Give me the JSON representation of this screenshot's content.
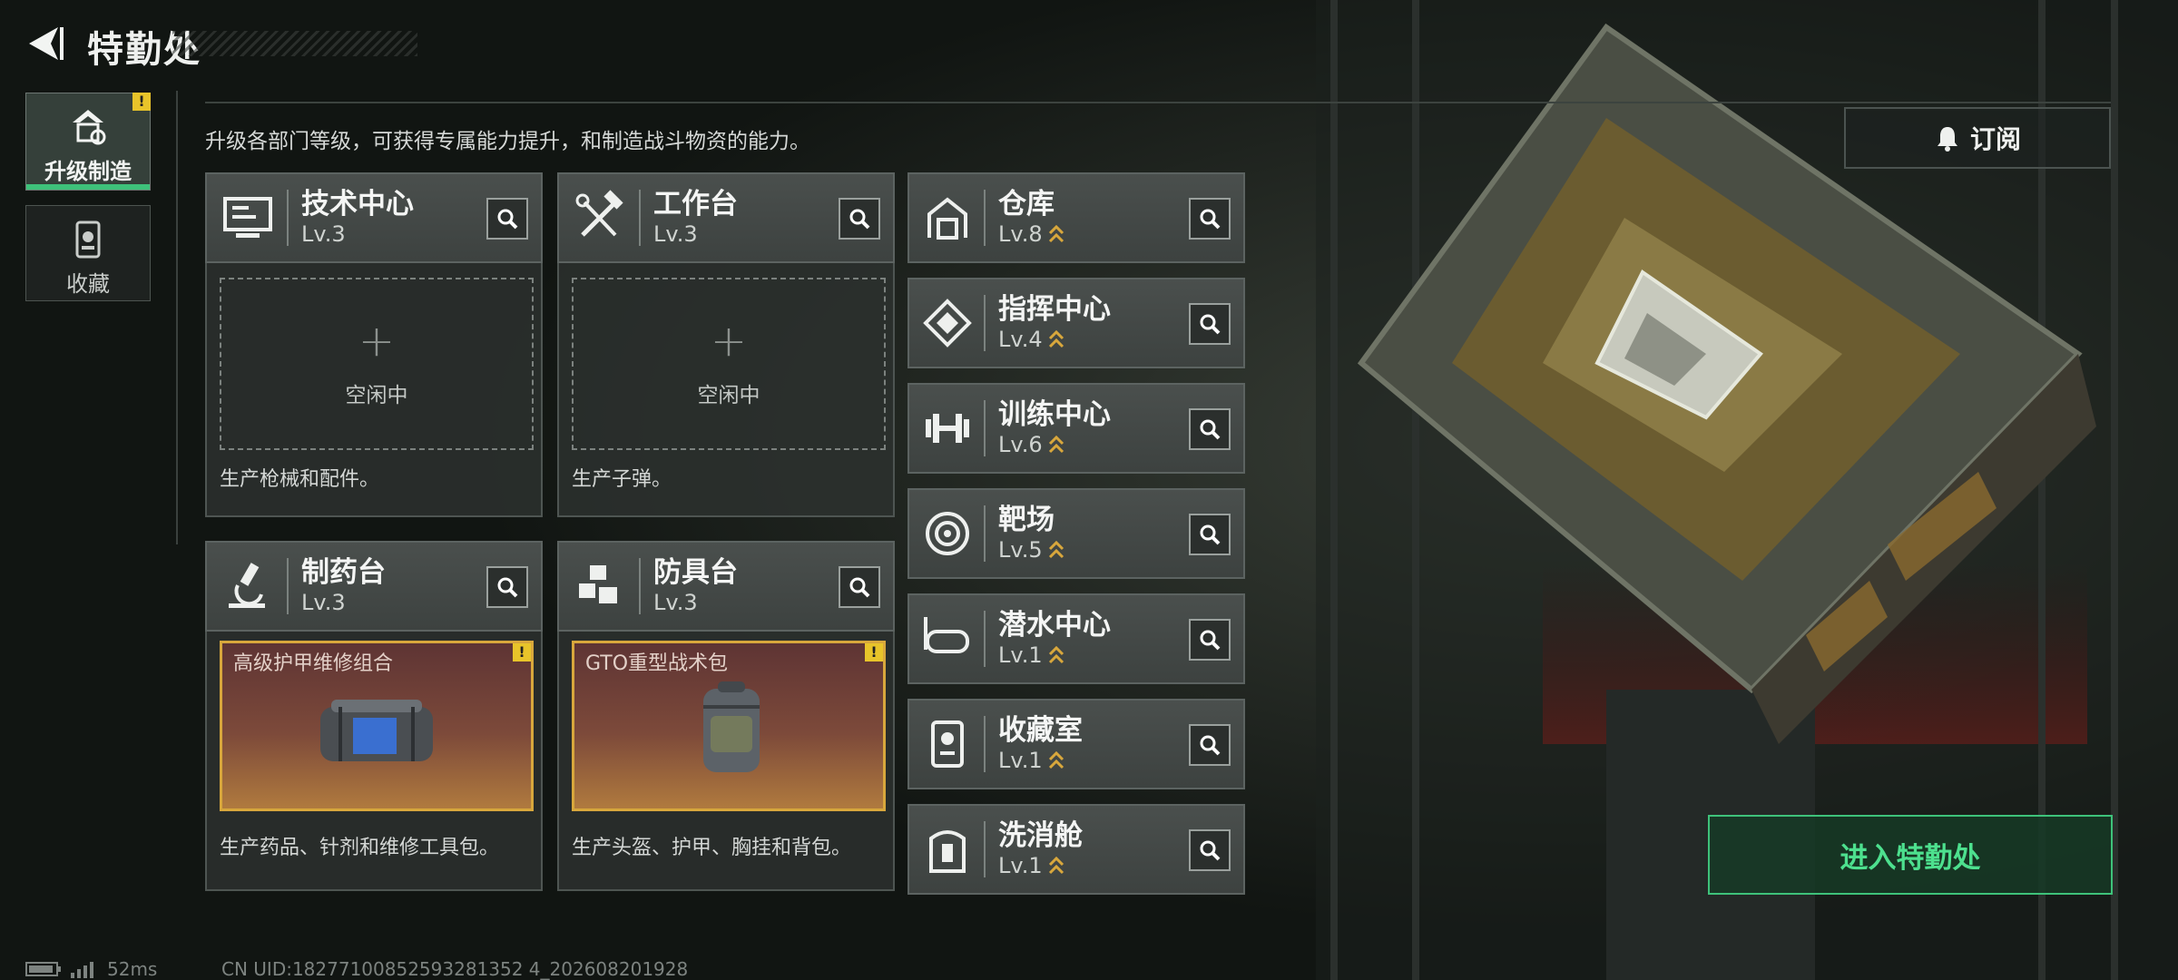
{
  "header": {
    "title": "特勤处"
  },
  "nav": [
    {
      "label": "升级制造",
      "icon": "upgrade-icon",
      "alert": "!"
    },
    {
      "label": "收藏",
      "icon": "collection-icon"
    }
  ],
  "description": "升级各部门等级，可获得专属能力提升，和制造战斗物资的能力。",
  "subscribe": {
    "label": "订阅",
    "icon": "bell-icon"
  },
  "workstations": [
    {
      "name": "技术中心",
      "level": "Lv.3",
      "icon": "monitor-icon",
      "slot_status": "空闲中",
      "plus": "+",
      "desc": "生产枪械和配件。"
    },
    {
      "name": "工作台",
      "level": "Lv.3",
      "icon": "hammer-wrench-icon",
      "slot_status": "空闲中",
      "plus": "+",
      "desc": "生产子弹。"
    },
    {
      "name": "制药台",
      "level": "Lv.3",
      "icon": "microscope-icon",
      "product": "高级护甲维修组合",
      "product_alert": "!",
      "desc": "生产药品、针剂和维修工具包。"
    },
    {
      "name": "防具台",
      "level": "Lv.3",
      "icon": "armor-blocks-icon",
      "product": "GTO重型战术包",
      "product_alert": "!",
      "desc": "生产头盔、护甲、胸挂和背包。"
    }
  ],
  "departments": [
    {
      "name": "仓库",
      "level": "Lv.8",
      "icon": "warehouse-icon"
    },
    {
      "name": "指挥中心",
      "level": "Lv.4",
      "icon": "command-icon"
    },
    {
      "name": "训练中心",
      "level": "Lv.6",
      "icon": "dumbbell-icon"
    },
    {
      "name": "靶场",
      "level": "Lv.5",
      "icon": "target-icon"
    },
    {
      "name": "潜水中心",
      "level": "Lv.1",
      "icon": "diving-mask-icon"
    },
    {
      "name": "收藏室",
      "level": "Lv.1",
      "icon": "trophy-case-icon"
    },
    {
      "name": "洗消舱",
      "level": "Lv.1",
      "icon": "decon-icon"
    }
  ],
  "enter_button": {
    "label": "进入特勤处"
  },
  "status": {
    "ping": "52ms",
    "uid": "CN UID:18277100852593281352 4_202608201928"
  },
  "colors": {
    "accent_green": "#3ec27a",
    "alert_yellow": "#e8c42a",
    "upgrade_gold": "#d8a73c"
  }
}
